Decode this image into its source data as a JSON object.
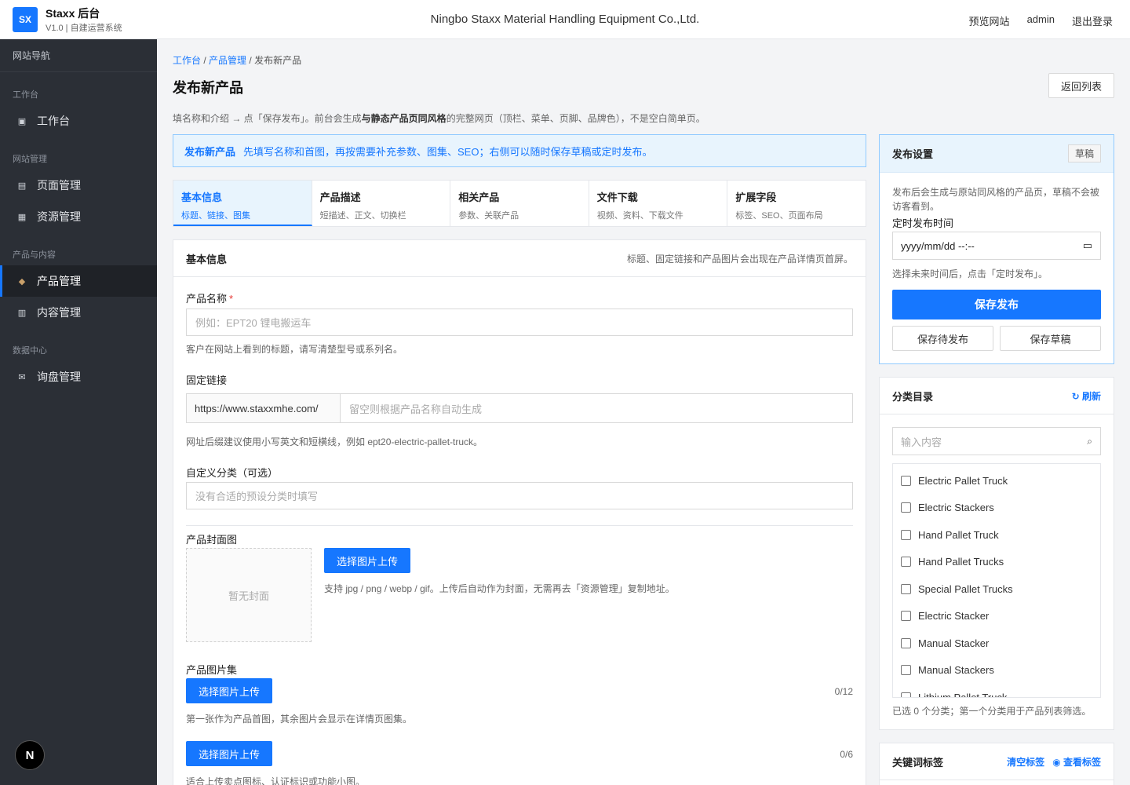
{
  "header": {
    "logo": "SX",
    "brand": "Staxx 后台",
    "version": "V1.0 | 自建运营系统",
    "company": "Ningbo Staxx Material Handling Equipment Co.,Ltd.",
    "links": [
      "预览网站",
      "admin",
      "退出登录"
    ]
  },
  "sidebar": {
    "title": "网站导航",
    "groups": [
      {
        "label": "工作台",
        "items": [
          {
            "label": "工作台",
            "icon": "grid-icon"
          }
        ]
      },
      {
        "label": "网站管理",
        "items": [
          {
            "label": "页面管理",
            "icon": "page-icon"
          },
          {
            "label": "资源管理",
            "icon": "image-icon"
          }
        ]
      },
      {
        "label": "产品与内容",
        "items": [
          {
            "label": "产品管理",
            "icon": "box-icon"
          },
          {
            "label": "内容管理",
            "icon": "doc-icon"
          }
        ]
      },
      {
        "label": "数据中心",
        "items": [
          {
            "label": "询盘管理",
            "icon": "mail-icon"
          }
        ]
      }
    ],
    "active": "产品管理",
    "bottom_badge": "N"
  },
  "breadcrumb": {
    "items": [
      "工作台",
      "产品管理"
    ],
    "current": "发布新产品"
  },
  "page": {
    "title": "发布新产品",
    "back_label": "返回列表",
    "desc_pre": "填名称和介绍 → 点「保存发布」。前台会生成",
    "desc_bold": "与静态产品页同风格",
    "desc_post": "的完整网页（顶栏、菜单、页脚、品牌色），不是空白简单页。"
  },
  "notice": {
    "bold": "发布新产品",
    "text": "先填写名称和首图，再按需要补充参数、图集、SEO；右侧可以随时保存草稿或定时发布。"
  },
  "tabs": [
    {
      "title": "基本信息",
      "sub": "标题、链接、图集"
    },
    {
      "title": "产品描述",
      "sub": "短描述、正文、切换栏"
    },
    {
      "title": "相关产品",
      "sub": "参数、关联产品"
    },
    {
      "title": "文件下载",
      "sub": "视频、资料、下载文件"
    },
    {
      "title": "扩展字段",
      "sub": "标签、SEO、页面布局"
    }
  ],
  "form": {
    "section_title": "基本信息",
    "section_hint": "标题、固定链接和产品图片会出现在产品详情页首屏。",
    "name_label": "产品名称",
    "name_required": "*",
    "name_placeholder": "例如：EPT20 锂电搬运车",
    "name_hint": "客户在网站上看到的标题，请写清楚型号或系列名。",
    "slug_label": "固定链接",
    "slug_prefix": "https://www.staxxmhe.com/",
    "slug_placeholder": "留空则根据产品名称自动生成",
    "slug_hint": "网址后缀建议使用小写英文和短横线，例如 ept20-electric-pallet-truck。",
    "cat_label": "自定义分类（可选）",
    "cat_placeholder": "没有合适的预设分类时填写",
    "cover_label": "产品封面图",
    "cover_empty": "暂无封面",
    "cover_button": "选择图片上传",
    "cover_hint": "支持 jpg / png / webp / gif。上传后自动作为封面，无需再去「资源管理」复制地址。",
    "gallery_label": "产品图片集",
    "gallery_button": "选择图片上传",
    "gallery_count": "0/12",
    "gallery_hint": "第一张作为产品首图，其余图片会显示在详情页图集。",
    "icons_button": "选择图片上传",
    "icons_count": "0/6",
    "icons_hint": "适合上传卖点图标、认证标识或功能小图。"
  },
  "publish": {
    "title": "发布设置",
    "badge": "草稿",
    "desc": "发布后会生成与原站同风格的产品页，草稿不会被访客看到。",
    "time_label": "定时发布时间",
    "time_value": "yyyy/mm/dd --:--",
    "time_hint": "选择未来时间后，点击「定时发布」。",
    "save_label": "保存发布",
    "pending_label": "保存待发布",
    "draft_label": "保存草稿"
  },
  "categories": {
    "title": "分类目录",
    "refresh": "↻ 刷新",
    "search_placeholder": "输入内容",
    "items": [
      "Electric Pallet Truck",
      "Electric Stackers",
      "Hand Pallet Truck",
      "Hand Pallet Trucks",
      "Special Pallet Trucks",
      "Electric Stacker",
      "Manual Stacker",
      "Manual Stackers",
      "Lithium Pallet Truck"
    ],
    "footer": "已选 0 个分类；第一个分类用于产品列表筛选。"
  },
  "keywords": {
    "title": "关键词标签",
    "clear": "清空标签",
    "view": "◉ 查看标签"
  },
  "colors": {
    "accent": "#1677ff",
    "sidebar": "#2b2f36",
    "notice_bg": "#e8f4fd"
  }
}
